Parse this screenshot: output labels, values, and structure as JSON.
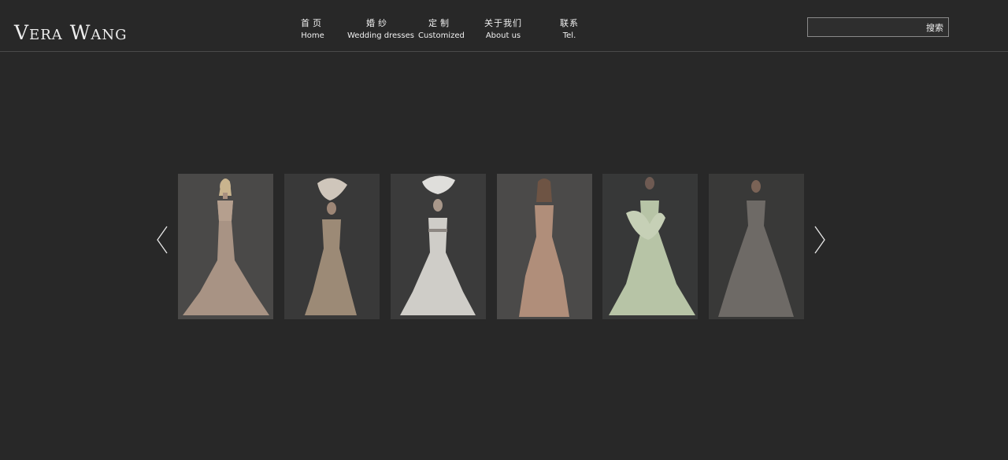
{
  "brand": {
    "logo_text": "Vera Wang"
  },
  "nav": {
    "items": [
      {
        "zh": "首页",
        "en": "Home"
      },
      {
        "zh": "婚纱",
        "en": "Wedding dresses"
      },
      {
        "zh": "定制",
        "en": "Customized"
      },
      {
        "zh": "关于我们",
        "en": "About us"
      },
      {
        "zh": "联系",
        "en": "Tel."
      }
    ]
  },
  "search": {
    "button_label": "搜索",
    "value": ""
  },
  "gallery": {
    "prev_icon": "chevron-left-icon",
    "next_icon": "chevron-right-icon",
    "items": [
      {
        "name": "dress-photo-1",
        "dress_color": "#a89384",
        "bg": "#4a4948"
      },
      {
        "name": "dress-photo-2",
        "dress_color": "#9c8a76",
        "bg": "#393939"
      },
      {
        "name": "dress-photo-3",
        "dress_color": "#cfcdc8",
        "bg": "#3b3b3b"
      },
      {
        "name": "dress-photo-4",
        "dress_color": "#b08e7a",
        "bg": "#4b4a49"
      },
      {
        "name": "dress-photo-5",
        "dress_color": "#b7c4a6",
        "bg": "#373838"
      },
      {
        "name": "dress-photo-6",
        "dress_color": "#6e6a66",
        "bg": "#393938"
      }
    ]
  },
  "colors": {
    "background": "#282828",
    "text": "#f0f0f0",
    "divider": "#4a4a4a"
  }
}
